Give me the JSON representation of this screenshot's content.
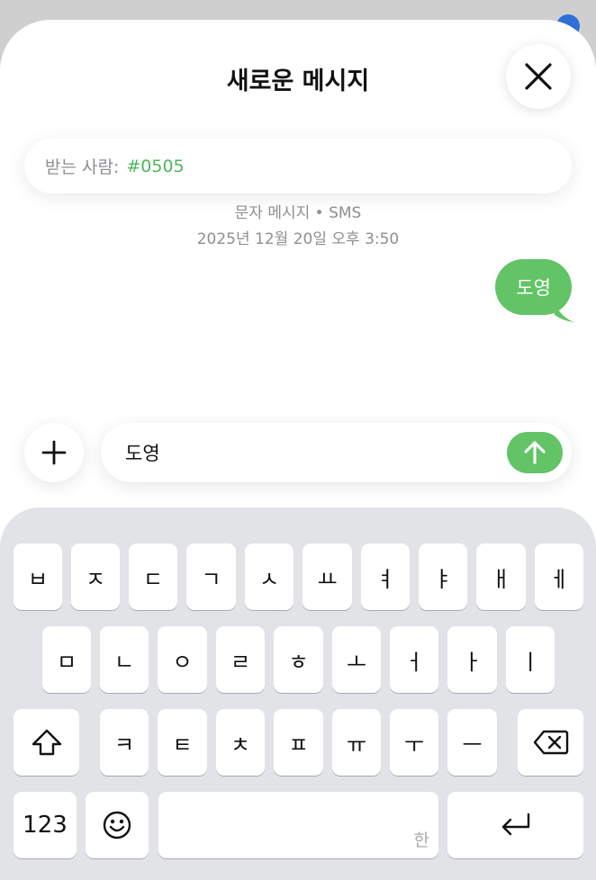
{
  "header": {
    "title": "새로운 메시지"
  },
  "recipient": {
    "label": "받는 사람:",
    "value": "#0505"
  },
  "thread": {
    "message_type": "문자 메시지 • SMS",
    "timestamp": "2025년 12월 20일 오후 3:50",
    "messages": [
      {
        "text": "도영",
        "sender": "me"
      }
    ]
  },
  "compose": {
    "text": "도영"
  },
  "keyboard": {
    "row1": [
      "ㅂ",
      "ㅈ",
      "ㄷ",
      "ㄱ",
      "ㅅ",
      "ㅛ",
      "ㅕ",
      "ㅑ",
      "ㅐ",
      "ㅔ"
    ],
    "row2": [
      "ㅁ",
      "ㄴ",
      "ㅇ",
      "ㄹ",
      "ㅎ",
      "ㅗ",
      "ㅓ",
      "ㅏ",
      "ㅣ"
    ],
    "row3": [
      "ㅋ",
      "ㅌ",
      "ㅊ",
      "ㅍ",
      "ㅠ",
      "ㅜ",
      "ㅡ"
    ],
    "numbers_label": "123",
    "space_label": "한"
  },
  "colors": {
    "accent": "#62c466",
    "recipient_text": "#4db65a",
    "keyboard_bg": "#e2e3e7"
  }
}
